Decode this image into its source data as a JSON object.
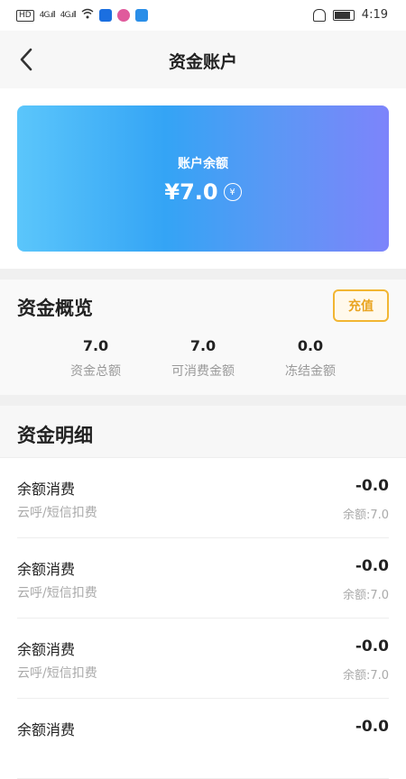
{
  "status_bar": {
    "left_chip": "HD",
    "signal1": "4G.ıll",
    "signal2": "4G.ıll",
    "time": "4:19"
  },
  "nav": {
    "title": "资金账户"
  },
  "balance_card": {
    "label": "账户余额",
    "amount": "¥7.0",
    "icon": "yen-coin-icon"
  },
  "overview": {
    "title": "资金概览",
    "recharge_label": "充值",
    "stats": [
      {
        "value": "7.0",
        "label": "资金总额"
      },
      {
        "value": "7.0",
        "label": "可消费金额"
      },
      {
        "value": "0.0",
        "label": "冻结金额"
      }
    ]
  },
  "details": {
    "title": "资金明细",
    "items": [
      {
        "title": "余额消费",
        "subtitle": "云呼/短信扣费",
        "amount": "-0.0",
        "balance": "余额:7.0"
      },
      {
        "title": "余额消费",
        "subtitle": "云呼/短信扣费",
        "amount": "-0.0",
        "balance": "余额:7.0"
      },
      {
        "title": "余额消费",
        "subtitle": "云呼/短信扣费",
        "amount": "-0.0",
        "balance": "余额:7.0"
      },
      {
        "title": "余额消费",
        "subtitle": "",
        "amount": "-0.0",
        "balance": ""
      }
    ]
  },
  "colors": {
    "accent_orange": "#f2b632",
    "card_gradient_start": "#5bc6fb",
    "card_gradient_end": "#7d84fb"
  }
}
